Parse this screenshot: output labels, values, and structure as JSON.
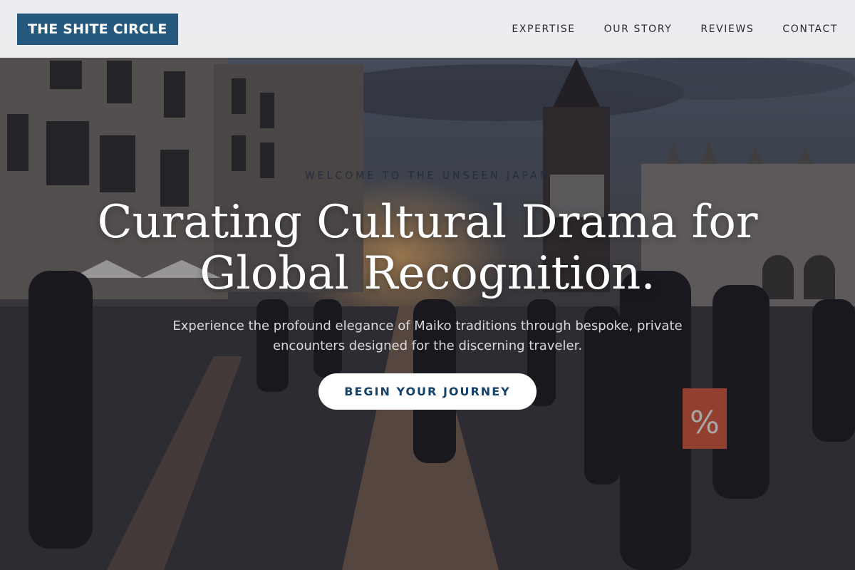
{
  "brand": {
    "name": "THE SHITE CIRCLE",
    "color": "#24587d"
  },
  "nav": {
    "items": [
      {
        "label": "EXPERTISE"
      },
      {
        "label": "OUR STORY"
      },
      {
        "label": "REVIEWS"
      },
      {
        "label": "CONTACT"
      }
    ]
  },
  "hero": {
    "eyebrow": "WELCOME TO THE UNSEEN JAPAN",
    "headline_line1": "Curating Cultural Drama for",
    "headline_line2": "Global Recognition.",
    "subtitle_line1": "Experience the profound elegance of Maiko traditions through bespoke, private",
    "subtitle_line2": "encounters designed for the discerning traveler.",
    "cta_label": "BEGIN YOUR JOURNEY",
    "cta_text_color": "#14416a"
  }
}
